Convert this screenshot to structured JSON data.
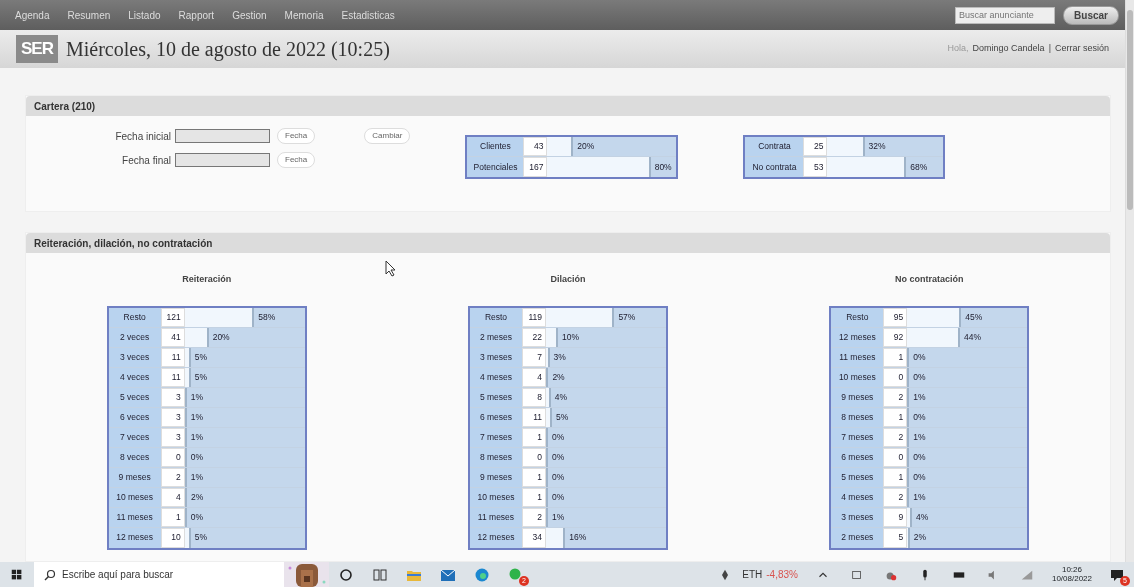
{
  "nav": {
    "items": [
      "Agenda",
      "Resumen",
      "Listado",
      "Rapport",
      "Gestion",
      "Memoria",
      "Estadisticas"
    ],
    "search": {
      "placeholder": "Buscar anunciante"
    },
    "search_button": "Buscar"
  },
  "header": {
    "logo": "SER",
    "title": "Miércoles, 10 de agosto de 2022 (10:25)",
    "greeting": "Hola,",
    "user": "Domingo Candela",
    "separator": "|",
    "logout": "Cerrar sesión"
  },
  "cartera": {
    "title": "Cartera (210)",
    "date_fields": [
      {
        "label": "Fecha inicial",
        "button": "Fecha"
      },
      {
        "label": "Fecha final",
        "button": "Fecha"
      }
    ],
    "change_button": "Cambiar",
    "tables": [
      [
        {
          "label": "Clientes",
          "count": "43",
          "percent": "20%",
          "level": 0.2
        },
        {
          "label": "Potenciales",
          "count": "167",
          "percent": "80%",
          "level": 0.8
        }
      ],
      [
        {
          "label": "Contrata",
          "count": "25",
          "percent": "32%",
          "level": 0.32
        },
        {
          "label": "No contrata",
          "count": "53",
          "percent": "68%",
          "level": 0.68
        }
      ]
    ]
  },
  "breakdown": {
    "title": "Reiteración, dilación, no contratación",
    "groups": [
      {
        "title": "Reiteración",
        "rows": [
          {
            "label": "Resto",
            "count": "121",
            "percent": "58%",
            "level": 0.58
          },
          {
            "label": "2 veces",
            "count": "41",
            "percent": "20%",
            "level": 0.2
          },
          {
            "label": "3 veces",
            "count": "11",
            "percent": "5%",
            "level": 0.05
          },
          {
            "label": "4 veces",
            "count": "11",
            "percent": "5%",
            "level": 0.05
          },
          {
            "label": "5 veces",
            "count": "3",
            "percent": "1%",
            "level": 0.01
          },
          {
            "label": "6 veces",
            "count": "3",
            "percent": "1%",
            "level": 0.01
          },
          {
            "label": "7 veces",
            "count": "3",
            "percent": "1%",
            "level": 0.01
          },
          {
            "label": "8 veces",
            "count": "0",
            "percent": "0%",
            "level": 0
          },
          {
            "label": "9 meses",
            "count": "2",
            "percent": "1%",
            "level": 0.01
          },
          {
            "label": "10 meses",
            "count": "4",
            "percent": "2%",
            "level": 0.02
          },
          {
            "label": "11 meses",
            "count": "1",
            "percent": "0%",
            "level": 0.01
          },
          {
            "label": "12 meses",
            "count": "10",
            "percent": "5%",
            "level": 0.05
          }
        ]
      },
      {
        "title": "Dilación",
        "rows": [
          {
            "label": "Resto",
            "count": "119",
            "percent": "57%",
            "level": 0.57
          },
          {
            "label": "2 meses",
            "count": "22",
            "percent": "10%",
            "level": 0.1
          },
          {
            "label": "3 meses",
            "count": "7",
            "percent": "3%",
            "level": 0.03
          },
          {
            "label": "4 meses",
            "count": "4",
            "percent": "2%",
            "level": 0.02
          },
          {
            "label": "5 meses",
            "count": "8",
            "percent": "4%",
            "level": 0.04
          },
          {
            "label": "6 meses",
            "count": "11",
            "percent": "5%",
            "level": 0.05
          },
          {
            "label": "7 meses",
            "count": "1",
            "percent": "0%",
            "level": 0.01
          },
          {
            "label": "8 meses",
            "count": "0",
            "percent": "0%",
            "level": 0
          },
          {
            "label": "9 meses",
            "count": "1",
            "percent": "0%",
            "level": 0.01
          },
          {
            "label": "10 meses",
            "count": "1",
            "percent": "0%",
            "level": 0.01
          },
          {
            "label": "11 meses",
            "count": "2",
            "percent": "1%",
            "level": 0.01
          },
          {
            "label": "12 meses",
            "count": "34",
            "percent": "16%",
            "level": 0.16
          }
        ]
      },
      {
        "title": "No contratación",
        "rows": [
          {
            "label": "Resto",
            "count": "95",
            "percent": "45%",
            "level": 0.45
          },
          {
            "label": "12 meses",
            "count": "92",
            "percent": "44%",
            "level": 0.44
          },
          {
            "label": "11 meses",
            "count": "1",
            "percent": "0%",
            "level": 0.01
          },
          {
            "label": "10 meses",
            "count": "0",
            "percent": "0%",
            "level": 0
          },
          {
            "label": "9 meses",
            "count": "2",
            "percent": "1%",
            "level": 0.01
          },
          {
            "label": "8 meses",
            "count": "1",
            "percent": "0%",
            "level": 0.01
          },
          {
            "label": "7 meses",
            "count": "2",
            "percent": "1%",
            "level": 0.01
          },
          {
            "label": "6 meses",
            "count": "0",
            "percent": "0%",
            "level": 0
          },
          {
            "label": "5 meses",
            "count": "1",
            "percent": "0%",
            "level": 0.01
          },
          {
            "label": "4 meses",
            "count": "2",
            "percent": "1%",
            "level": 0.01
          },
          {
            "label": "3 meses",
            "count": "9",
            "percent": "4%",
            "level": 0.04
          },
          {
            "label": "2 meses",
            "count": "5",
            "percent": "2%",
            "level": 0.02
          }
        ]
      }
    ]
  },
  "taskbar": {
    "search": {
      "placeholder": "Escribe aquí para buscar"
    },
    "app_badge": "2",
    "ticker": {
      "symbol": "ETH",
      "change": "-4,83%"
    },
    "time": "10:26",
    "date": "10/08/2022",
    "notification_count": "5"
  }
}
